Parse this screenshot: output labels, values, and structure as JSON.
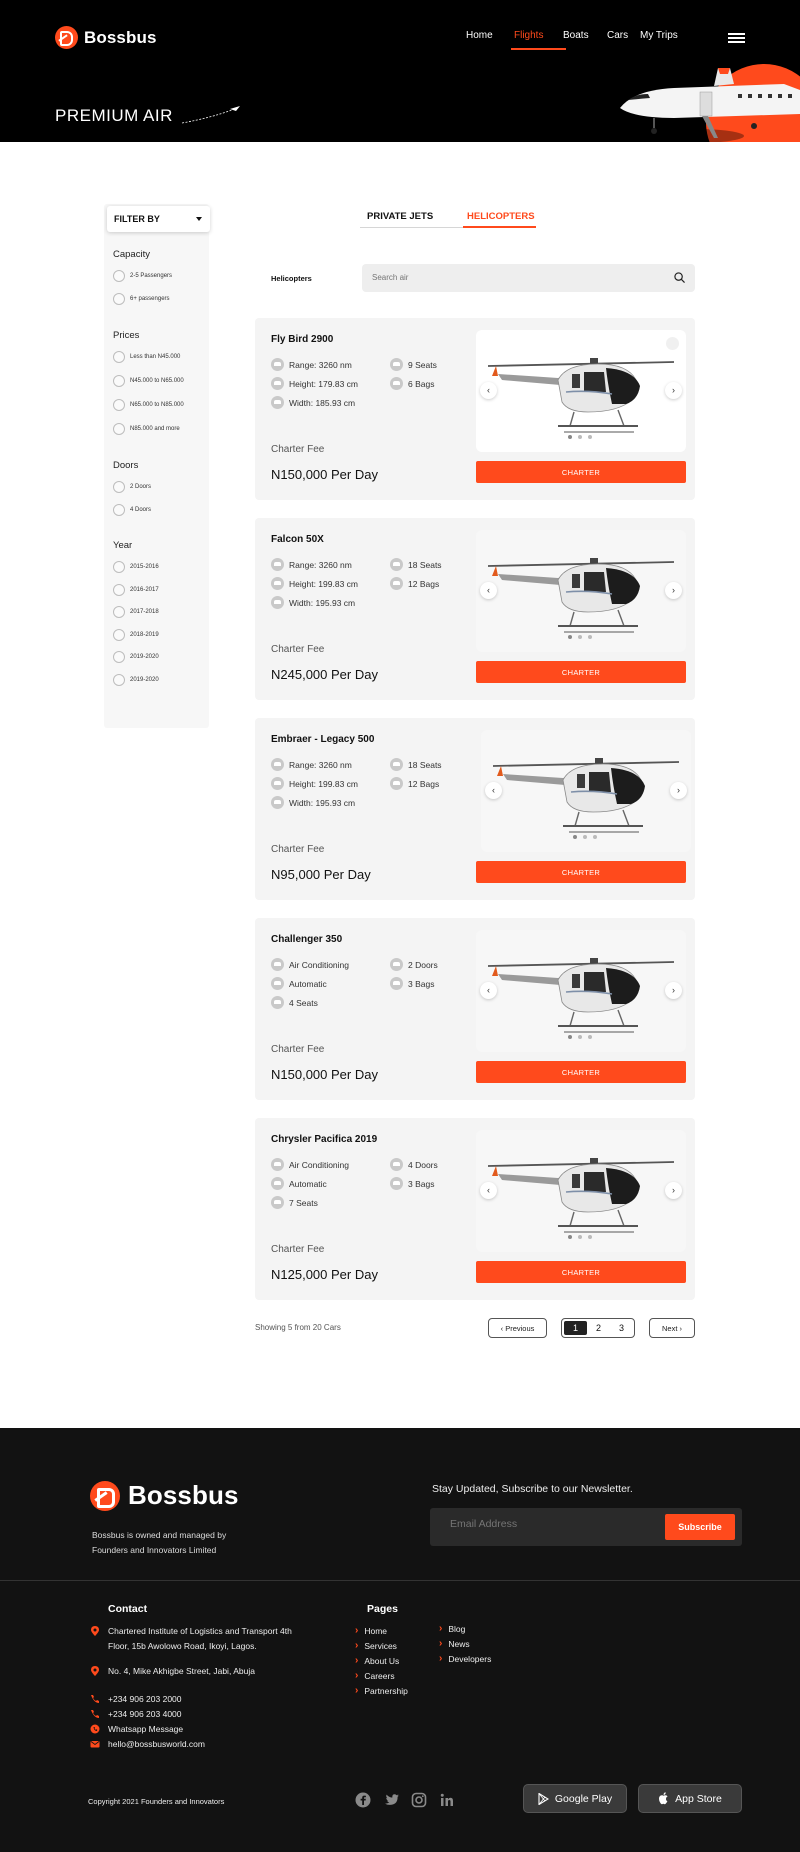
{
  "brand": {
    "name": "Bossbus",
    "accent": "#ff4a1c"
  },
  "nav": [
    "Home",
    "Flights",
    "Boats",
    "Cars",
    "My Trips"
  ],
  "nav_active": "Flights",
  "hero": {
    "title": "PREMIUM AIR"
  },
  "filter": {
    "button": "FILTER BY",
    "groups": [
      {
        "title": "Capacity",
        "options": [
          "2-5 Passengers",
          "6+ passengers"
        ]
      },
      {
        "title": "Prices",
        "options": [
          "Less than N45.000",
          "N45.000 to N65.000",
          "N65.000 to N85.000",
          "N85.000 and more"
        ]
      },
      {
        "title": "Doors",
        "options": [
          "2 Doors",
          "4 Doors"
        ]
      },
      {
        "title": "Year",
        "options": [
          "2015-2016",
          "2016-2017",
          "2017-2018",
          "2018-2019",
          "2019-2020",
          "2019-2020"
        ]
      }
    ]
  },
  "tabs": [
    "PRIVATE JETS",
    "HELICOPTERS"
  ],
  "tab_active": "HELICOPTERS",
  "search": {
    "label": "Helicopters",
    "placeholder": "Search air"
  },
  "listings": [
    {
      "title": "Fly Bird 2900",
      "features_left": [
        "Range: 3260 nm",
        "Height: 179.83 cm",
        "Width: 185.93 cm"
      ],
      "features_right": [
        "9 Seats",
        "6 Bags"
      ],
      "fee_label": "Charter Fee",
      "price": "N150,000 Per Day",
      "cta": "CHARTER"
    },
    {
      "title": "Falcon 50X",
      "features_left": [
        "Range: 3260 nm",
        "Height: 199.83 cm",
        "Width: 195.93 cm"
      ],
      "features_right": [
        "18 Seats",
        "12 Bags"
      ],
      "fee_label": "Charter Fee",
      "price": "N245,000 Per Day",
      "cta": "CHARTER"
    },
    {
      "title": "Embraer - Legacy 500",
      "features_left": [
        "Range: 3260 nm",
        "Height: 199.83 cm",
        "Width: 195.93 cm"
      ],
      "features_right": [
        "18 Seats",
        "12 Bags"
      ],
      "fee_label": "Charter Fee",
      "price": "N95,000 Per Day",
      "cta": "CHARTER"
    },
    {
      "title": "Challenger 350",
      "features_left": [
        "Air Conditioning",
        "Automatic",
        "4 Seats"
      ],
      "features_right": [
        "2 Doors",
        "3 Bags"
      ],
      "fee_label": "Charter Fee",
      "price": "N150,000 Per Day",
      "cta": "CHARTER"
    },
    {
      "title": "Chrysler Pacifica 2019",
      "features_left": [
        "Air Conditioning",
        "Automatic",
        "7 Seats"
      ],
      "features_right": [
        "4 Doors",
        "3 Bags"
      ],
      "fee_label": "Charter Fee",
      "price": "N125,000 Per Day",
      "cta": "CHARTER"
    }
  ],
  "pagination": {
    "showing": "Showing 5 from 20 Cars",
    "previous": "Previous",
    "next": "Next",
    "pages": [
      "1",
      "2",
      "3"
    ],
    "current": "1"
  },
  "footer": {
    "about": "Bossbus is owned and managed by Founders and Innovators Limited",
    "newsletter_title": "Stay Updated, Subscribe to our Newsletter.",
    "email_placeholder": "Email Address",
    "subscribe": "Subscribe",
    "contact_title": "Contact",
    "contact": [
      {
        "icon": "location-icon",
        "text": "Chartered Institute of Logistics and Transport 4th Floor, 15b Awolowo Road, Ikoyi, Lagos."
      },
      {
        "icon": "location-icon",
        "text": "No. 4, Mike Akhigbe Street, Jabi, Abuja"
      },
      {
        "icon": "phone-icon",
        "text": "+234 906 203 2000"
      },
      {
        "icon": "phone-icon",
        "text": "+234 906 203 4000"
      },
      {
        "icon": "whatsapp-icon",
        "text": "Whatsapp Message"
      },
      {
        "icon": "mail-icon",
        "text": "hello@bossbusworld.com"
      }
    ],
    "pages_title": "Pages",
    "pages_col1": [
      "Home",
      "Services",
      "About Us",
      "Careers",
      "Partnership"
    ],
    "pages_col2": [
      "Blog",
      "News",
      "Developers"
    ],
    "copyright": "Copyright 2021 Founders and Innovators",
    "social": [
      "facebook-icon",
      "twitter-icon",
      "instagram-icon",
      "linkedin-icon"
    ],
    "google_play": "Google Play",
    "app_store": "App Store"
  }
}
